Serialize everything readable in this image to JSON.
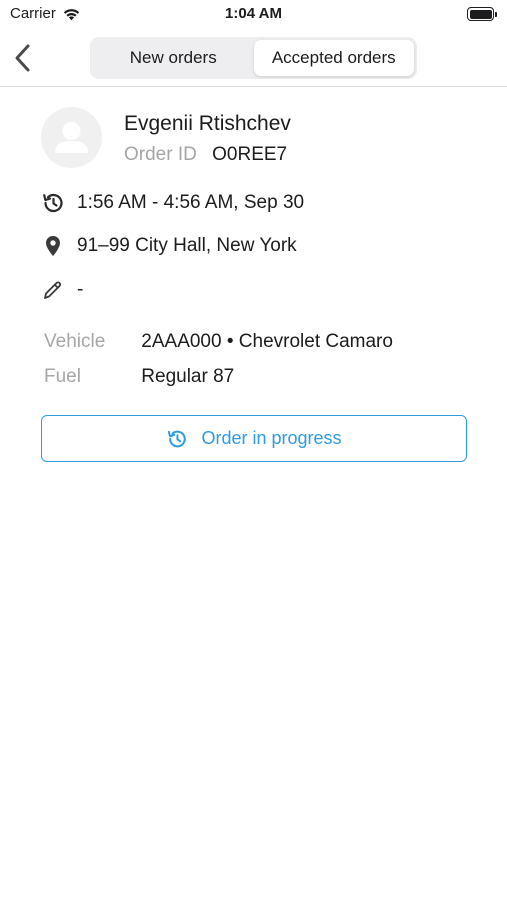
{
  "status_bar": {
    "carrier": "Carrier",
    "time": "1:04 AM"
  },
  "nav": {
    "tabs": [
      {
        "label": "New orders",
        "active": false
      },
      {
        "label": "Accepted orders",
        "active": true
      }
    ]
  },
  "order": {
    "customer_name": "Evgenii Rtishchev",
    "order_id_label": "Order ID",
    "order_id": "O0REE7",
    "time_window": "1:56 AM - 4:56 AM, Sep 30",
    "address": "91–99 City Hall, New York",
    "note": "-",
    "vehicle_label": "Vehicle",
    "vehicle": "2AAA000 • Chevrolet Camaro",
    "fuel_label": "Fuel",
    "fuel": "Regular 87",
    "status_button": "Order in progress"
  },
  "icons": {
    "back": "chevron-left-icon",
    "history": "history-icon",
    "location": "location-pin-icon",
    "note": "pencil-icon",
    "avatar": "user-placeholder-icon"
  },
  "colors": {
    "accent": "#2f9be0",
    "muted_text": "#a6a6a6",
    "primary_text": "#1c1c1e",
    "segment_bg": "#eeeef0"
  }
}
